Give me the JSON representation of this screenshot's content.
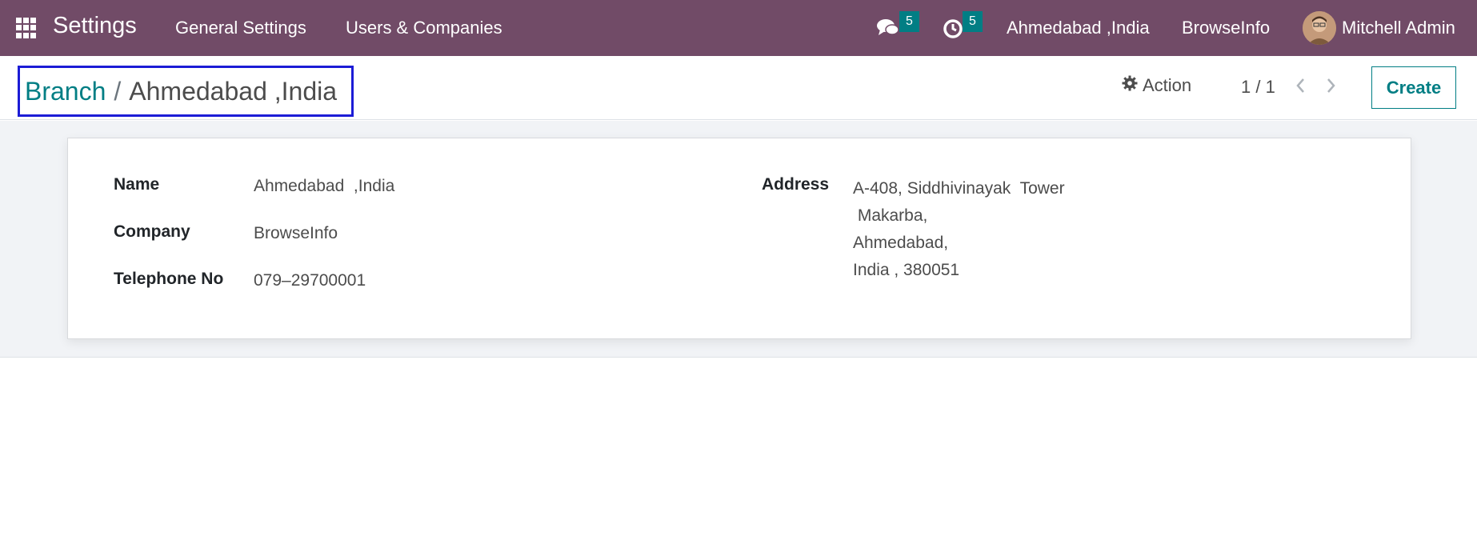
{
  "navbar": {
    "app_title": "Settings",
    "menu": [
      "General Settings",
      "Users & Companies"
    ],
    "messages_icon": "chat-bubbles-icon",
    "messages_count": "5",
    "activities_icon": "clock-icon",
    "activities_count": "5",
    "branch_switcher": "Ahmedabad ,India",
    "company_switcher": "BrowseInfo",
    "user_name": "Mitchell Admin",
    "colors": {
      "navbar_bg": "#714B67",
      "badge_bg": "#017e84"
    }
  },
  "control_panel": {
    "breadcrumb_parent": "Branch",
    "breadcrumb_separator": "/",
    "breadcrumb_current": "Ahmedabad ,India",
    "action_label": "Action",
    "pager": "1 / 1",
    "create_label": "Create",
    "accent_color": "#017e84"
  },
  "form": {
    "name_label": "Name",
    "name_value": "Ahmedabad  ,India",
    "company_label": "Company",
    "company_value": "BrowseInfo",
    "telephone_label": "Telephone No",
    "telephone_value": "079–29700001",
    "address_label": "Address",
    "address_value": "A-408, Siddhivinayak  Tower\n Makarba,\nAhmedabad,\nIndia , 380051"
  }
}
